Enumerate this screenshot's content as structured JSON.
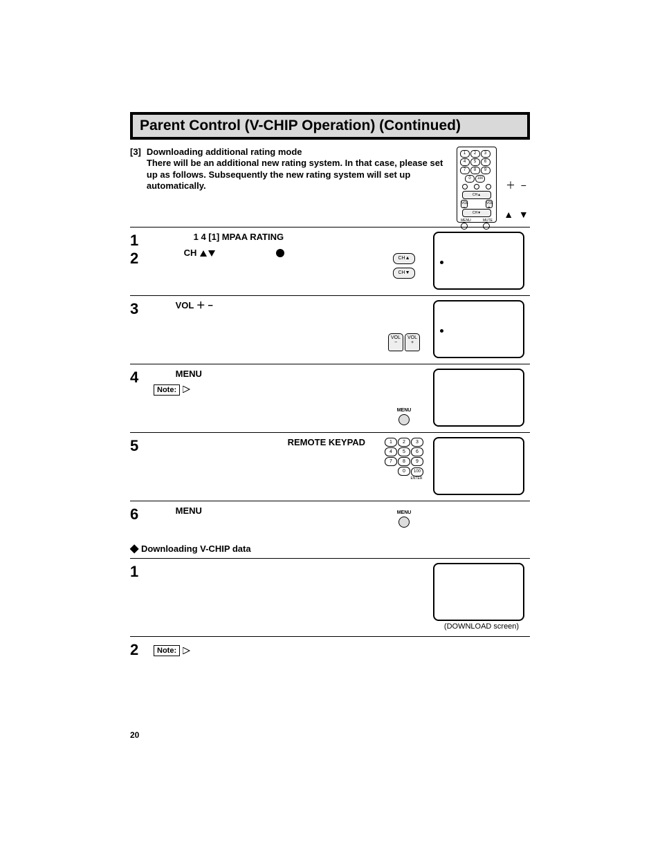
{
  "title": "Parent Control (V-CHIP Operation) (Continued)",
  "intro": {
    "bracket": "[3]",
    "heading": "Downloading additional rating mode",
    "body": "There will be an additional new rating system. In that case, please set up as follows. Subsequently the new rating system will set up automatically."
  },
  "side_symbols": {
    "plus": "＋",
    "minus": "−",
    "up": "▲",
    "down": "▼"
  },
  "remote_small": {
    "keys": [
      "1",
      "2",
      "3",
      "4",
      "5",
      "6",
      "7",
      "8",
      "9",
      "0",
      "100"
    ],
    "ch_up": "CH▲",
    "ch_dn": "CH▼",
    "vol": "VOL",
    "menu": "MENU",
    "mute": "MUTE",
    "plus": "+",
    "minus": "–"
  },
  "steps_a": [
    {
      "num": "1",
      "line1_prefix": "",
      "line1_bold": "1     4    [1] MPAA RATING",
      "has_screen": false,
      "has_border": false
    },
    {
      "num": "2",
      "text_before_ch": "",
      "ch_label": "CH",
      "after_arrows": "",
      "controls": "ch",
      "has_screen": true,
      "screen_dot": true
    },
    {
      "num": "3",
      "vol_label": "VOL ＋ −",
      "controls": "vol",
      "has_screen": true,
      "screen_dot": true
    },
    {
      "num": "4",
      "menu_label": "MENU",
      "note": "Note:",
      "controls": "menu",
      "has_screen": true,
      "screen_dot": false
    },
    {
      "num": "5",
      "keypad_label": "REMOTE KEYPAD",
      "controls": "keypad",
      "has_screen": true,
      "screen_dot": false
    },
    {
      "num": "6",
      "menu_label": "MENU",
      "controls": "menu",
      "has_screen": false,
      "has_border": false
    }
  ],
  "bullet_heading": "Downloading V-CHIP data",
  "steps_b": [
    {
      "num": "1",
      "has_screen": true,
      "screen_caption": "(DOWNLOAD screen)"
    },
    {
      "num": "2",
      "note": "Note:",
      "has_screen": false
    }
  ],
  "keypad": [
    "1",
    "2",
    "3",
    "4",
    "5",
    "6",
    "7",
    "8",
    "9",
    "0",
    "100"
  ],
  "keypad_enter": "ENTER",
  "ch_buttons": {
    "up": "CH▲",
    "down": "CH▼"
  },
  "vol_buttons": {
    "minus": "VOL\n−",
    "plus": "VOL\n+"
  },
  "menu_button": "MENU",
  "page_number": "20"
}
